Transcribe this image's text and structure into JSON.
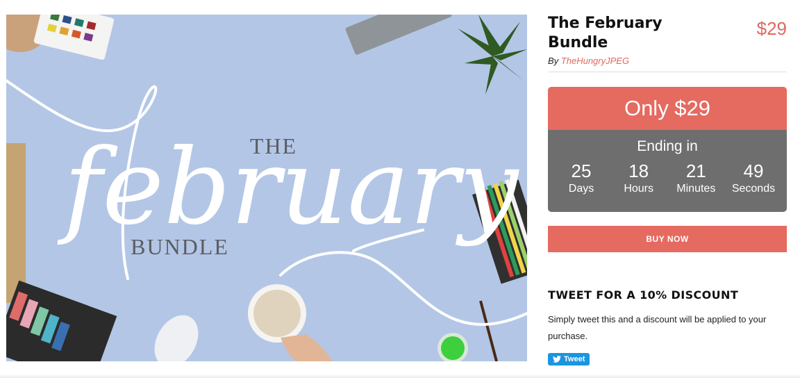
{
  "hero": {
    "line1": "THE",
    "script": "february",
    "line2": "BUNDLE"
  },
  "product": {
    "title": "The February Bundle",
    "price": "$29",
    "by_label": "By",
    "author": "TheHungryJPEG"
  },
  "deal": {
    "headline": "Only $29",
    "ending_label": "Ending in",
    "countdown": [
      {
        "value": "25",
        "unit": "Days"
      },
      {
        "value": "18",
        "unit": "Hours"
      },
      {
        "value": "21",
        "unit": "Minutes"
      },
      {
        "value": "49",
        "unit": "Seconds"
      }
    ],
    "buy_label": "BUY NOW"
  },
  "tweet": {
    "heading": "TWEET FOR A 10% DISCOUNT",
    "text": "Simply tweet this and a discount will be applied to your purchase.",
    "button_label": "Tweet"
  },
  "colors": {
    "accent": "#e56a60",
    "countdown_bg": "#6e6e6e",
    "twitter": "#1b95e0",
    "hero_bg": "#b3c6e6"
  }
}
